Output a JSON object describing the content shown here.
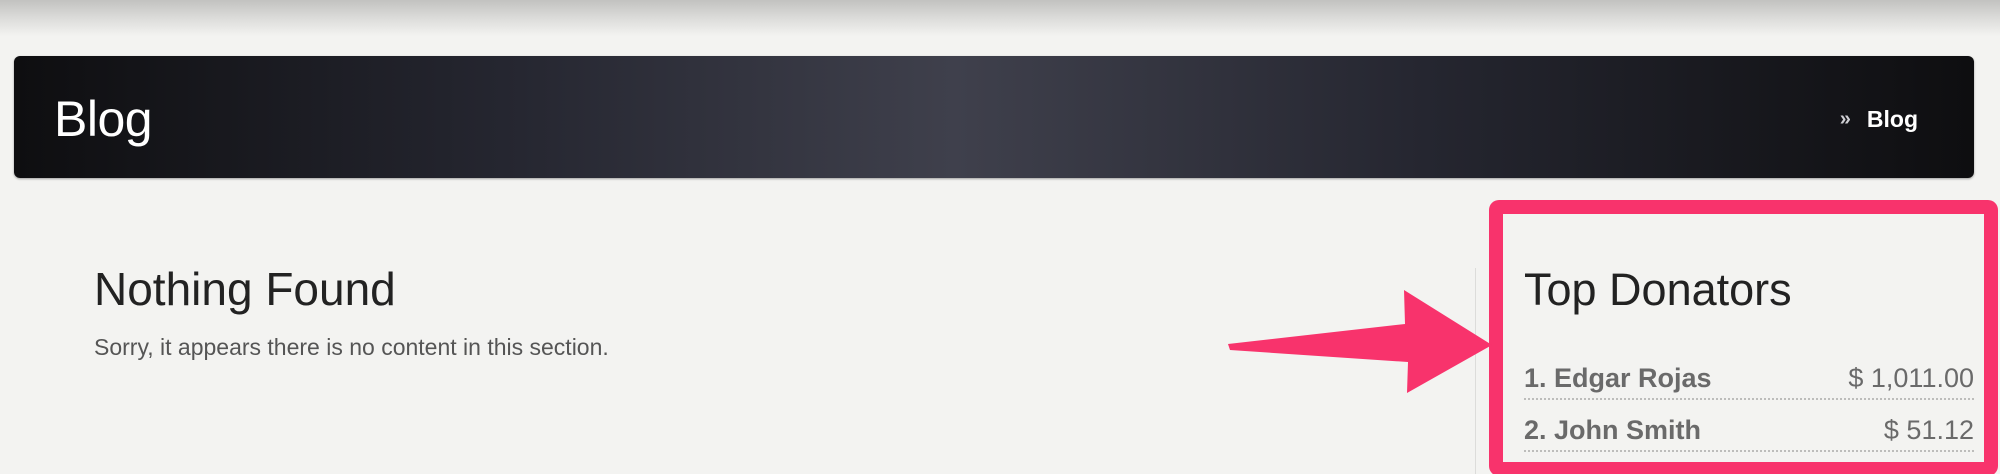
{
  "header": {
    "title": "Blog",
    "breadcrumb_separator": "»",
    "breadcrumb_current": "Blog"
  },
  "content": {
    "title": "Nothing Found",
    "message": "Sorry, it appears there is no content in this section."
  },
  "sidebar": {
    "title": "Top Donators",
    "donators": [
      {
        "name": "1. Edgar Rojas",
        "amount": "$ 1,011.00"
      },
      {
        "name": "2. John Smith",
        "amount": "$ 51.12"
      }
    ]
  },
  "annotation": {
    "highlight_color": "#f8336c"
  }
}
